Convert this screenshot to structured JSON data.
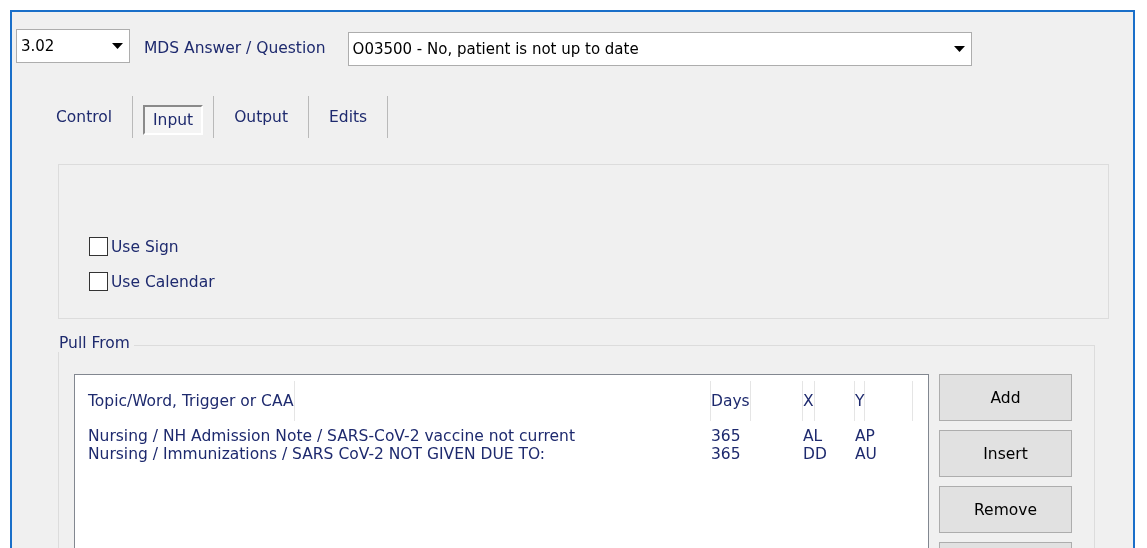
{
  "version_select": {
    "value": "3.02"
  },
  "question_label": "MDS Answer / Question",
  "question_select": {
    "value": "O03500 - No, patient is not up to date"
  },
  "tabs": [
    {
      "label": "Control",
      "selected": false
    },
    {
      "label": "Input",
      "selected": true
    },
    {
      "label": "Output",
      "selected": false
    },
    {
      "label": "Edits",
      "selected": false
    }
  ],
  "options": [
    {
      "label": "Use Sign",
      "checked": false
    },
    {
      "label": "Use Calendar",
      "checked": false
    }
  ],
  "pull_from": {
    "title": "Pull From",
    "columns": [
      "Topic/Word, Trigger or CAA",
      "Days",
      "X",
      "Y"
    ],
    "rows": [
      [
        "Nursing / NH Admission Note / SARS-CoV-2 vaccine not current",
        "365",
        "AL",
        "AP"
      ],
      [
        "Nursing / Immunizations / SARS CoV-2 NOT GIVEN DUE TO:",
        "365",
        "DD",
        "AU"
      ]
    ],
    "buttons": [
      "Add",
      "Insert",
      "Remove"
    ]
  }
}
